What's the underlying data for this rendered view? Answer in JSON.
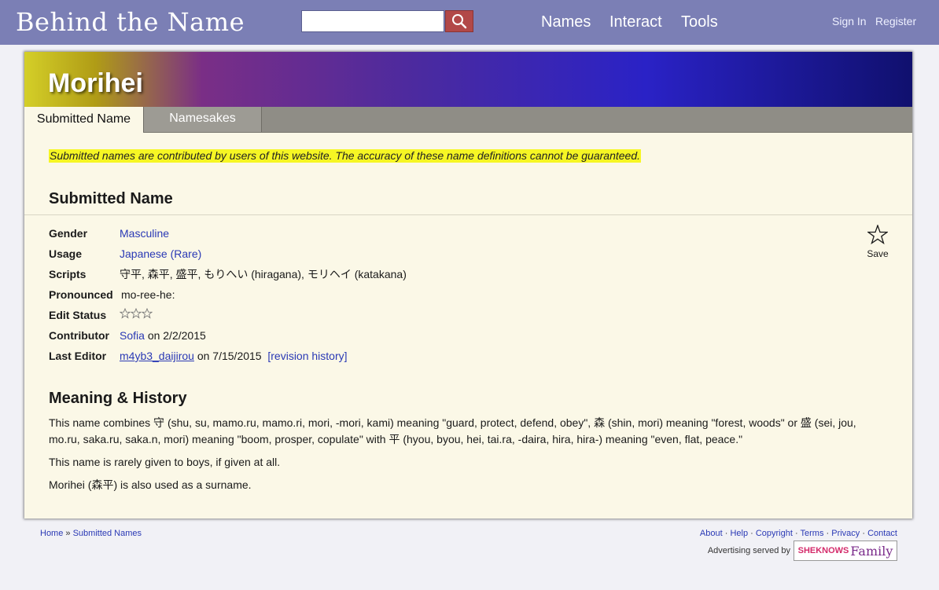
{
  "header": {
    "logo_text": "Behind the Name",
    "search": {
      "value": "",
      "placeholder": ""
    },
    "nav": [
      "Names",
      "Interact",
      "Tools"
    ],
    "sign_in": "Sign In",
    "register": "Register"
  },
  "page": {
    "title": "Morihei",
    "tabs": [
      {
        "label": "Submitted Name",
        "active": true
      },
      {
        "label": "Namesakes",
        "active": false
      }
    ],
    "disclaimer": "Submitted names are contributed by users of this website. The accuracy of these name definitions cannot be guaranteed.",
    "section_title": "Submitted Name",
    "save_label": "Save",
    "details": {
      "gender_label": "Gender",
      "gender_value": "Masculine",
      "usage_label": "Usage",
      "usage_value": "Japanese (Rare)",
      "scripts_label": "Scripts",
      "scripts_value": "守平, 森平, 盛平, もりへい (hiragana), モリヘイ (katakana)",
      "pronounced_label": "Pronounced",
      "pronounced_value": "mo-ree-he:",
      "edit_status_label": "Edit Status",
      "edit_status_stars": 0,
      "contributor_label": "Contributor",
      "contributor_name": "Sofia",
      "contributor_date": "on 2/2/2015",
      "last_editor_label": "Last Editor",
      "last_editor_name": "m4yb3_daijirou",
      "last_editor_date": "on 7/15/2015",
      "revision_history": "[revision history]"
    },
    "meaning_title": "Meaning & History",
    "meaning_paragraphs": [
      "This name combines 守 (shu, su, mamo.ru, mamo.ri, mori, -mori, kami) meaning \"guard, protect, defend, obey\", 森 (shin, mori) meaning \"forest, woods\" or 盛 (sei, jou, mo.ru, saka.ru, saka.n, mori) meaning \"boom, prosper, copulate\" with 平 (hyou, byou, hei, tai.ra, -daira, hira, hira-) meaning \"even, flat, peace.\"",
      "This name is rarely given to boys, if given at all.",
      "Morihei (森平) is also used as a surname."
    ]
  },
  "footer": {
    "breadcrumb": [
      "Home",
      "Submitted Names"
    ],
    "breadcrumb_sep": "»",
    "links": [
      "About",
      "Help",
      "Copyright",
      "Terms",
      "Privacy",
      "Contact"
    ],
    "advertising": "Advertising served by",
    "ad_brand_prefix": "SHEKNOWS",
    "ad_brand_word": "Family"
  },
  "colors": {
    "topbar": "#7b7fb5",
    "card_bg": "#fbf8e7",
    "link": "#2a39b5",
    "highlight": "#f6f624"
  }
}
